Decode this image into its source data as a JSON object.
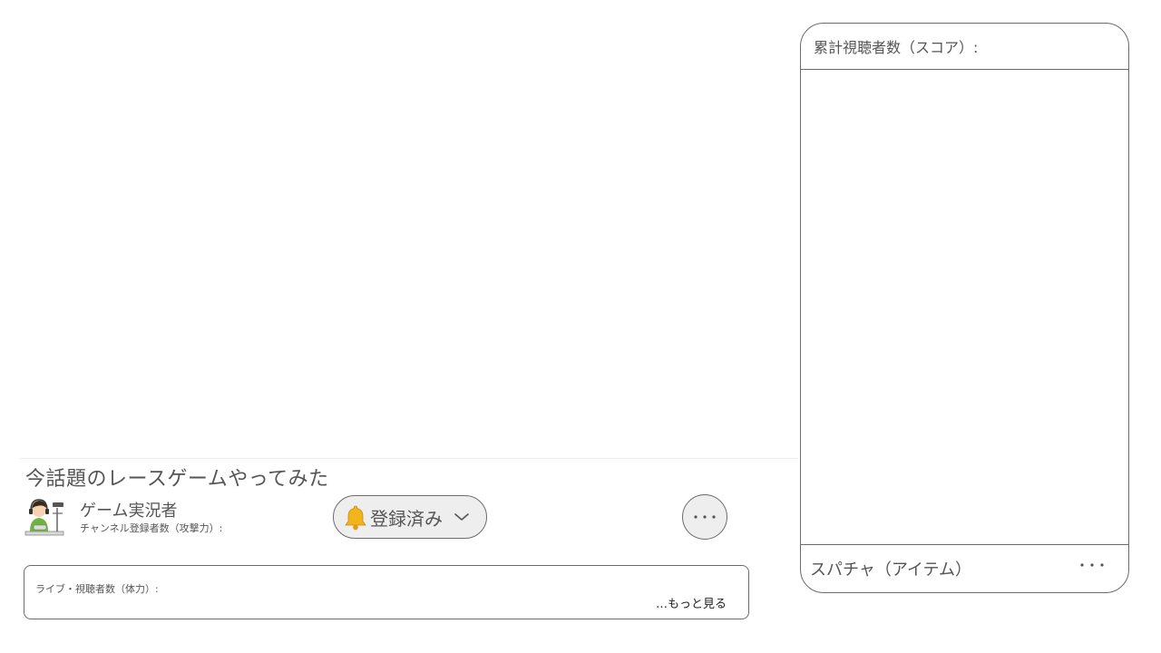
{
  "video": {
    "title": "今話題のレースゲームやってみた"
  },
  "channel": {
    "name": "ゲーム実況者",
    "subscriber_label": "チャンネル登録者数（攻撃力）:",
    "avatar_icon": "streamer-avatar-icon"
  },
  "subscribe": {
    "label": "登録済み",
    "bell_icon": "bell-icon",
    "chevron_icon": "chevron-down-icon",
    "bell_color": "#f2b51c"
  },
  "actions": {
    "more_label": "⋯"
  },
  "description": {
    "live_viewers_label": "ライブ・視聴者数（体力）:",
    "show_more_label": "…もっと見る"
  },
  "chat": {
    "score_label": "累計視聴者数（スコア）:",
    "superchat_label": "スパチャ（アイテム）",
    "more_label": "⋯"
  }
}
